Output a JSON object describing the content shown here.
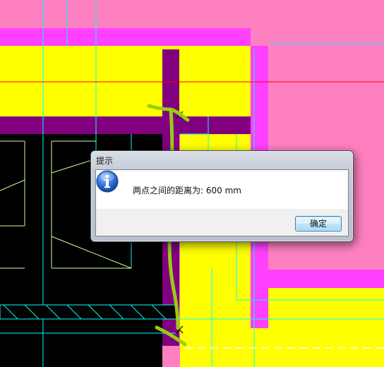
{
  "dialog": {
    "title": "提示",
    "message": "两点之间的距离为: 600 mm",
    "ok_label": "确定",
    "icon": "info-icon"
  },
  "colors": {
    "background_pink": "#ff80c0",
    "yellow": "#ffff00",
    "magenta": "#ff40ff",
    "purple": "#800080",
    "black": "#000000",
    "cyan_line": "#00ffff",
    "red_line": "#ff0000",
    "green_stroke": "#99cc11",
    "light_green_line": "#ccff99",
    "dialog_button_border": "#3c7fb1"
  },
  "annotation": {
    "measured_distance_mm": 600
  }
}
